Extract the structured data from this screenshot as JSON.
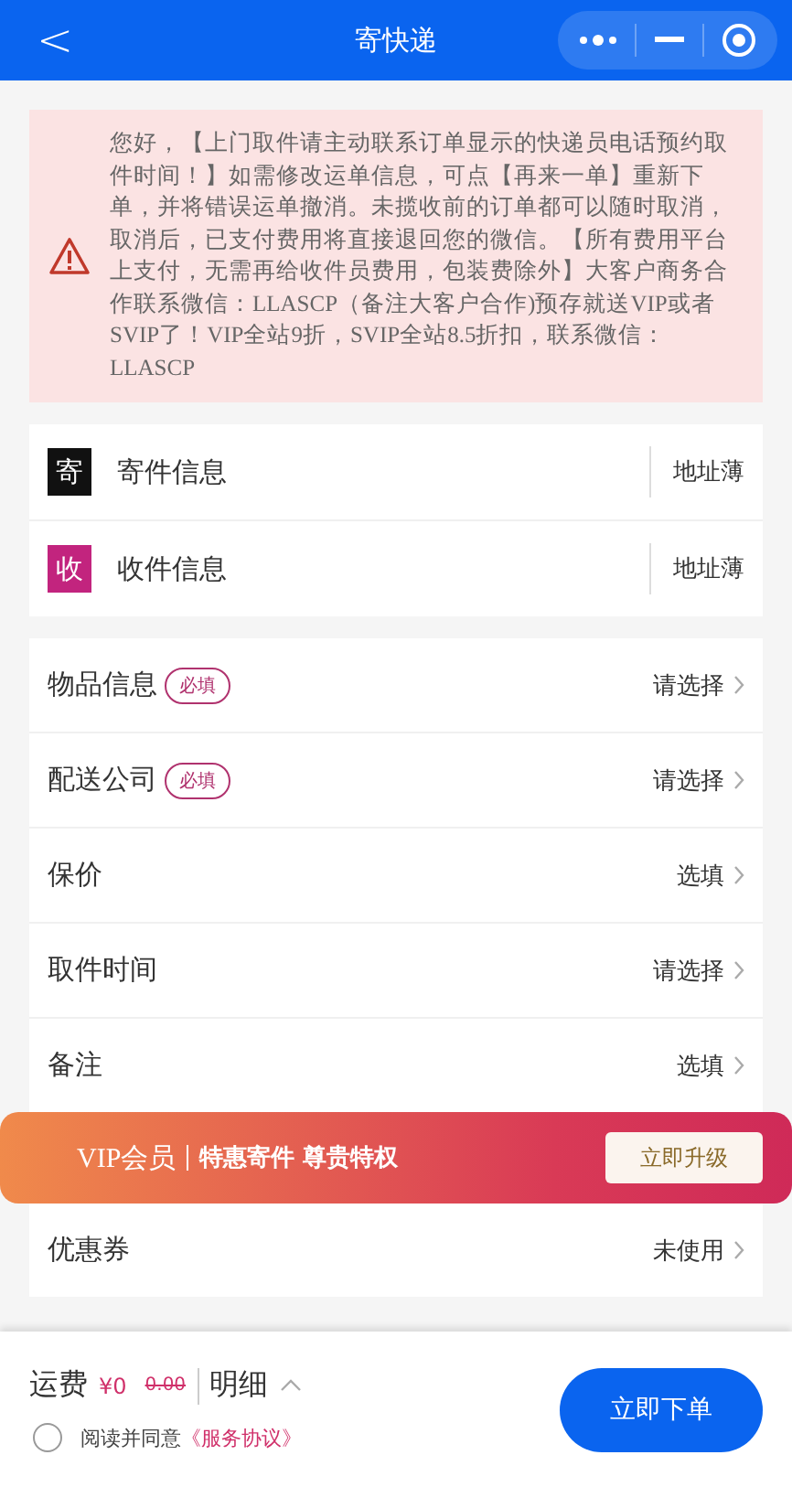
{
  "header": {
    "back": "<",
    "title": "寄快递"
  },
  "notice": {
    "text": "您好，【上门取件请主动联系订单显示的快递员电话预约取件时间！】如需修改运单信息，可点【再来一单】重新下单，并将错误运单撤消。未揽收前的订单都可以随时取消，取消后，已支付费用将直接退回您的微信。【所有费用平台上支付，无需再给收件员费用，包装费除外】大客户商务合作联系微信：LLASCP（备注大客户合作)预存就送VIP或者SVIP了！VIP全站9折，SVIP全站8.5折扣，联系微信：LLASCP"
  },
  "addresses": [
    {
      "badge": "寄",
      "color": "#111111",
      "label": "寄件信息",
      "action": "地址薄"
    },
    {
      "badge": "收",
      "color": "#c2247e",
      "label": "收件信息",
      "action": "地址薄"
    }
  ],
  "fields": [
    {
      "label": "物品信息",
      "required": true,
      "tag": "必填",
      "value": "请选择"
    },
    {
      "label": "配送公司",
      "required": true,
      "tag": "必填",
      "value": "请选择"
    },
    {
      "label": "保价",
      "required": false,
      "value": "选填"
    },
    {
      "label": "取件时间",
      "required": false,
      "value": "请选择"
    },
    {
      "label": "备注",
      "required": false,
      "value": "选填"
    }
  ],
  "vip_banner": {
    "title": "VIP会员",
    "subtitle": "特惠寄件 尊贵特权",
    "button": "立即升级"
  },
  "coupon": {
    "label": "优惠券",
    "value": "未使用"
  },
  "footer": {
    "fee_label": "运费",
    "price": "¥0",
    "old_price": "0.00",
    "details": "明细",
    "agree_checked": false,
    "agree_text": "阅读并同意",
    "agreement_link": "《服务协议》",
    "submit": "立即下单"
  }
}
